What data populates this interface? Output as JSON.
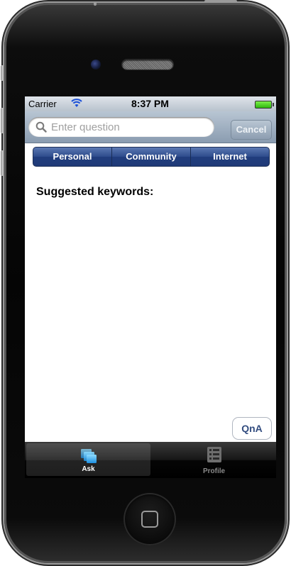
{
  "device": {
    "home_button": "home-square-icon"
  },
  "status_bar": {
    "carrier": "Carrier",
    "time": "8:37 PM",
    "wifi_icon": "wifi-icon",
    "battery_icon": "battery-icon",
    "battery_color": "#3ccb16"
  },
  "search": {
    "placeholder": "Enter question",
    "value": "",
    "cancel_label": "Cancel",
    "icon": "search-icon"
  },
  "segments": [
    {
      "label": "Personal"
    },
    {
      "label": "Community"
    },
    {
      "label": "Internet"
    }
  ],
  "content": {
    "keywords_title": "Suggested keywords:",
    "qna_label": "QnA"
  },
  "tab_bar": {
    "items": [
      {
        "label": "Ask",
        "icon": "ask-cards-icon",
        "active": true
      },
      {
        "label": "Profile",
        "icon": "profile-list-icon",
        "active": false
      }
    ]
  },
  "colors": {
    "segment_blue": "#2d4b8c",
    "search_bar": "#a0b1c3",
    "active_tab_icon": "#3ab0f0",
    "qna_text": "#334d80"
  }
}
